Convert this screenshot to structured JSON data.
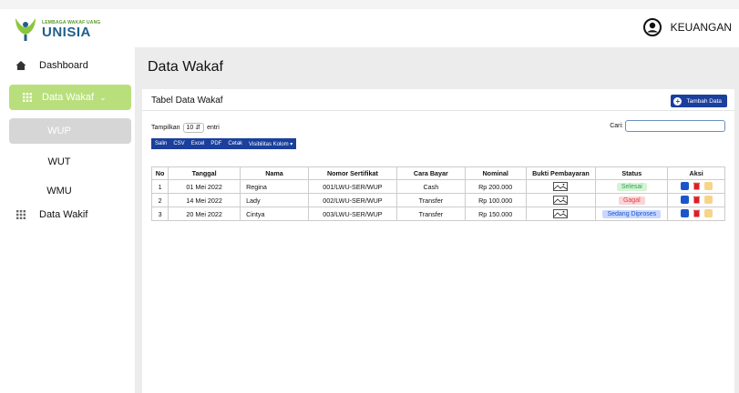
{
  "brand": {
    "small_text": "LEMBAGA WAKAF UANG",
    "big_text": "UNISIA",
    "green": "#5a9a2a",
    "blue": "#1f5f8a"
  },
  "user": {
    "name": "KEUANGAN",
    "icon": "user-circle-icon"
  },
  "sidebar": {
    "items": [
      {
        "label": "Dashboard",
        "icon": "home-icon"
      },
      {
        "label": "Data Wakaf",
        "icon": "grid-icon",
        "active": true
      },
      {
        "label": "WUP",
        "selected": true
      },
      {
        "label": "WUT"
      },
      {
        "label": "WMU"
      },
      {
        "label": "Data Wakif",
        "icon": "grid-icon"
      }
    ],
    "accent": "#b9df7d"
  },
  "main": {
    "page_title": "Data Wakaf",
    "card_title": "Tabel Data Wakaf",
    "add_button": "Tambah Data",
    "length": {
      "prefix": "Tampilkan",
      "value": "10",
      "suffix": "entri"
    },
    "search": {
      "label": "Cari:",
      "value": ""
    },
    "export_buttons": [
      "Salin",
      "CSV",
      "Excel",
      "PDF",
      "Cetak",
      "Visibilitas Kolom ▾"
    ]
  },
  "table": {
    "headers": [
      "No",
      "Tanggal",
      "Nama",
      "Nomor Sertifikat",
      "Cara Bayar",
      "Nominal",
      "Bukti Pembayaran",
      "Status",
      "Aksi"
    ],
    "rows": [
      {
        "no": "1",
        "tanggal": "01 Mei 2022",
        "nama": "Regina",
        "nomor": "001/LWU-SER/WUP",
        "cara": "Cash",
        "nominal": "Rp 200.000",
        "status": "Selesai",
        "status_type": "ok"
      },
      {
        "no": "2",
        "tanggal": "14 Mei 2022",
        "nama": "Lady",
        "nomor": "002/LWU-SER/WUP",
        "cara": "Transfer",
        "nominal": "Rp 100.000",
        "status": "Gagal",
        "status_type": "fail"
      },
      {
        "no": "3",
        "tanggal": "20 Mei 2022",
        "nama": "Cintya",
        "nomor": "003/LWU-SER/WUP",
        "cara": "Transfer",
        "nominal": "Rp 150.000",
        "status": "Sedang Diproses",
        "status_type": "proc"
      }
    ]
  },
  "colors": {
    "primary": "#1a3f9c",
    "main_bg": "#ececec"
  }
}
